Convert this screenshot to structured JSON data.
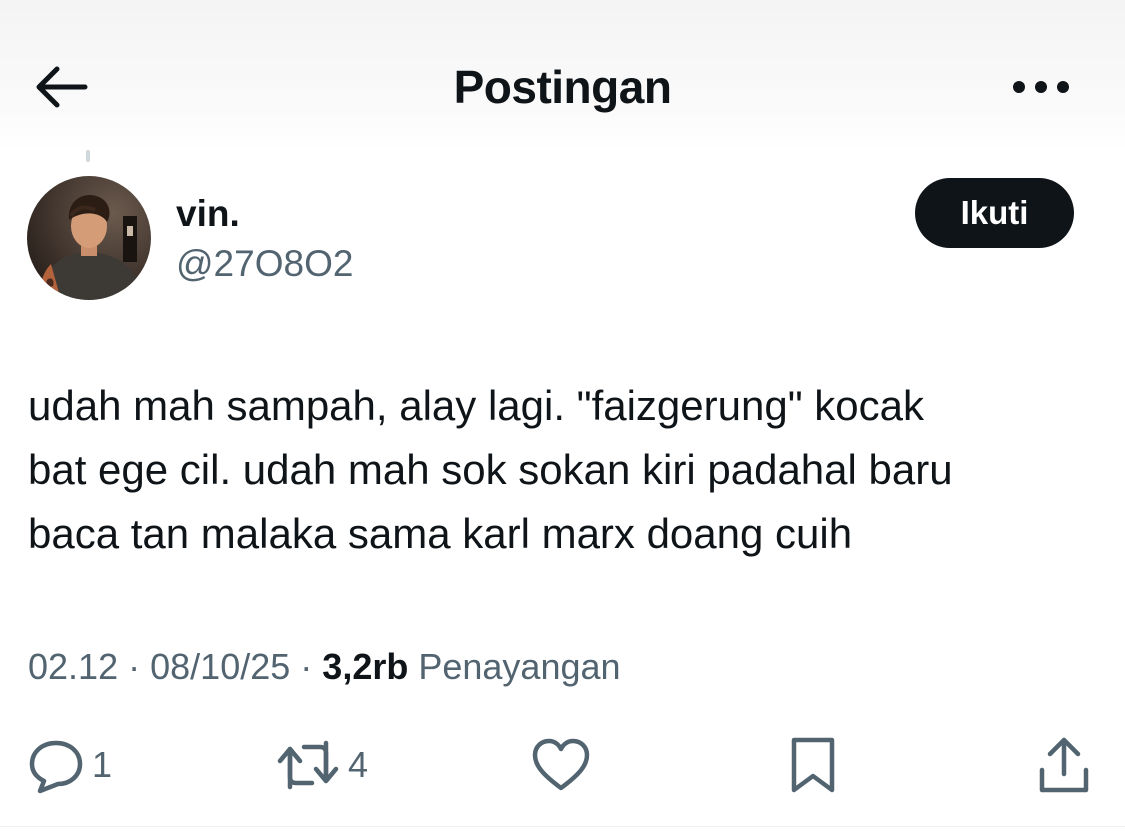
{
  "header": {
    "title": "Postingan",
    "back_icon": "arrow-left-icon",
    "more_icon": "more-horizontal-icon"
  },
  "author": {
    "display_name": "vin.",
    "handle": "@27O8O2",
    "follow_label": "Ikuti"
  },
  "tweet": {
    "lines": [
      "udah mah sampah, alay lagi. \"faizgerung\" kocak",
      "bat ege cil. udah mah sok sokan kiri padahal baru",
      "baca tan malaka sama karl marx doang cuih"
    ]
  },
  "meta": {
    "time": "02.12",
    "date": "08/10/25",
    "separator": "·",
    "views_count": "3,2rb",
    "views_label": "Penayangan"
  },
  "actions": {
    "reply_count": "1",
    "retweet_count": "4",
    "like_icon": "heart-icon",
    "bookmark_icon": "bookmark-icon",
    "share_icon": "share-icon"
  },
  "colors": {
    "text_primary": "#0f1419",
    "text_secondary": "#536471",
    "follow_bg": "#0f1419"
  }
}
